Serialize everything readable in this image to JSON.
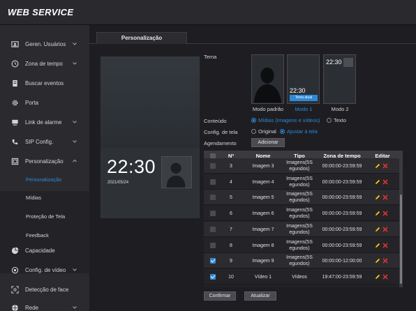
{
  "app": {
    "brand": "WEB SERVICE"
  },
  "sidebar": {
    "items": [
      {
        "label": "Geren. Usuários",
        "icon": "user-card-icon"
      },
      {
        "label": "Zona de tempo",
        "icon": "clock-icon"
      },
      {
        "label": "Buscar eventos",
        "icon": "document-icon"
      },
      {
        "label": "Porta",
        "icon": "gear-icon"
      },
      {
        "label": "Link de alarme",
        "icon": "monitor-icon"
      },
      {
        "label": "SIP Config.",
        "icon": "phone-icon"
      },
      {
        "label": "Personalização",
        "icon": "frame-icon"
      },
      {
        "label": "Capacidade",
        "icon": "pie-chart-icon"
      },
      {
        "label": "Config. de vídeo",
        "icon": "camera-icon"
      },
      {
        "label": "Detecção de face",
        "icon": "face-scan-icon"
      },
      {
        "label": "Rede",
        "icon": "network-icon"
      }
    ],
    "subitems": [
      {
        "label": "Personalização",
        "active": true
      },
      {
        "label": "Mídias",
        "active": false
      },
      {
        "label": "Proteção de Tela",
        "active": false
      },
      {
        "label": "Feedback",
        "active": false
      }
    ]
  },
  "main": {
    "tab": "Personalização",
    "preview": {
      "time": "22:30",
      "date": "2021/05/24"
    },
    "tema_label": "Tema",
    "themes": [
      {
        "label": "Modo padrão",
        "active": false
      },
      {
        "label": "Modo 1",
        "active": true,
        "badge": "Tema atual",
        "time": "22:30"
      },
      {
        "label": "Modo 2",
        "active": false,
        "time": "22:30"
      }
    ],
    "conteudo": {
      "label": "Conteúdo",
      "options": [
        "Mídias (Imagens e vídeos)",
        "Texto"
      ],
      "selected": 0
    },
    "config_tela": {
      "label": "Config. de tela",
      "options": [
        "Original",
        "Ajustar à tela"
      ],
      "selected": 1
    },
    "agendamento": {
      "label": "Agendamento",
      "button": "Adicionar"
    },
    "table": {
      "headers": [
        "Nº",
        "Nome",
        "Tipo",
        "Zona de tempo",
        "Editar"
      ],
      "rows": [
        {
          "n": "3",
          "nome": "Imagem 3",
          "tipo": "Imagens(5S egundos)",
          "zona": "00:00:00-23:59:59",
          "checked": false
        },
        {
          "n": "4",
          "nome": "Imagem 4",
          "tipo": "Imagens(5S egundos)",
          "zona": "00:00:00-23:59:59",
          "checked": false
        },
        {
          "n": "5",
          "nome": "Imagem 5",
          "tipo": "Imagens(5S egundos)",
          "zona": "00:00:00-23:59:59",
          "checked": false
        },
        {
          "n": "6",
          "nome": "Imagem 6",
          "tipo": "Imagens(5S egundos)",
          "zona": "00:00:00-23:59:59",
          "checked": false
        },
        {
          "n": "7",
          "nome": "Imagem 7",
          "tipo": "Imagens(5S egundos)",
          "zona": "00:00:00-23:59:59",
          "checked": false
        },
        {
          "n": "8",
          "nome": "Imagem 8",
          "tipo": "Imagens(5S egundos)",
          "zona": "00:00:00-23:59:59",
          "checked": false
        },
        {
          "n": "9",
          "nome": "Imagem 9",
          "tipo": "Imagens(5S egundos)",
          "zona": "00:00:00-12:00:00",
          "checked": true
        },
        {
          "n": "10",
          "nome": "Vídeo 1",
          "tipo": "Vídeos",
          "zona": "19:47:00-23:59:59",
          "checked": true
        }
      ]
    },
    "buttons": {
      "confirmar": "Confirmar",
      "atualizar": "Atualizar"
    }
  },
  "colors": {
    "accent": "#2e8ad8",
    "edit": "#f0d000",
    "delete": "#e03030"
  }
}
